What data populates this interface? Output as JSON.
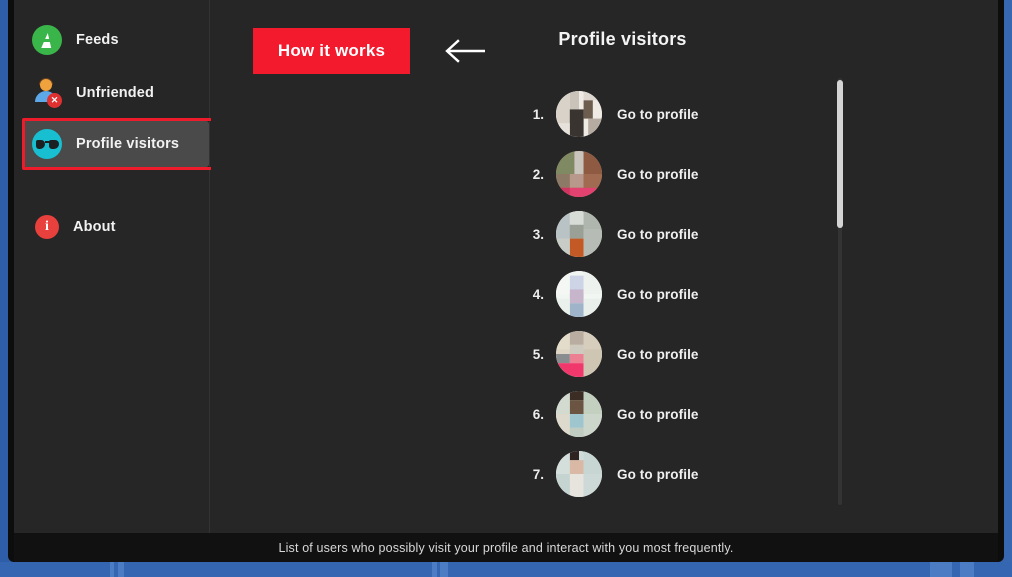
{
  "window": {
    "accent_red": "#f31a2e",
    "selection_border": "#ee1c2b",
    "background": "#262626",
    "sidebar_background": "#262626",
    "desktop_background": "#3a6bb5"
  },
  "sidebar": {
    "items": [
      {
        "label": "Feeds",
        "icon": "feeds-rss-icon",
        "selected": false
      },
      {
        "label": "Unfriended",
        "icon": "person-remove-icon",
        "selected": false
      },
      {
        "label": "Profile visitors",
        "icon": "spy-sunglasses-icon",
        "selected": true
      },
      {
        "label": "About",
        "icon": "info-circle-icon",
        "selected": false
      }
    ],
    "about_badge": "i",
    "unfriend_badge": "✕"
  },
  "toolbar": {
    "how_it_works_label": "How it works",
    "back_arrow_icon": "arrow-left-icon"
  },
  "main": {
    "title": "Profile visitors",
    "go_to_profile_label": "Go to profile",
    "visitors": [
      {
        "rank": "1.",
        "action": "Go to profile"
      },
      {
        "rank": "2.",
        "action": "Go to profile"
      },
      {
        "rank": "3.",
        "action": "Go to profile"
      },
      {
        "rank": "4.",
        "action": "Go to profile"
      },
      {
        "rank": "5.",
        "action": "Go to profile"
      },
      {
        "rank": "6.",
        "action": "Go to profile"
      },
      {
        "rank": "7.",
        "action": "Go to profile"
      }
    ]
  },
  "status_bar": {
    "text": "List of users who possibly visit your profile and interact with you most frequently."
  }
}
